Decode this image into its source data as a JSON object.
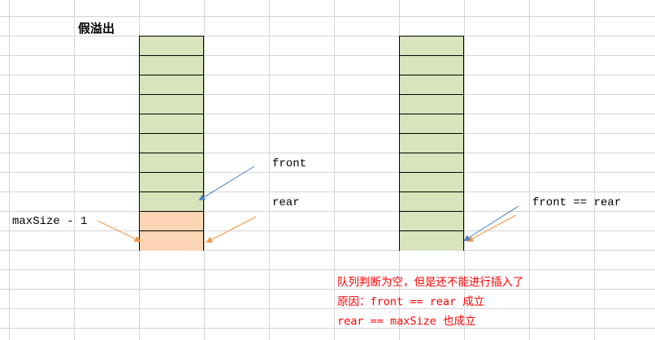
{
  "title": "假溢出",
  "left_queue": {
    "cells": 11,
    "orange_cells": 2
  },
  "right_queue": {
    "cells": 11
  },
  "labels": {
    "front": "front",
    "rear": "rear",
    "max_size_minus_one": "maxSize - 1",
    "front_eq_rear": "front == rear"
  },
  "notes": [
    "队列判断为空，但是还不能进行插入了",
    "原因：front == rear 成立",
    "rear == maxSize  也成立"
  ],
  "colors": {
    "green": "#d8e4bc",
    "orange": "#fcd5b4",
    "blue_arrow": "#4f81bd",
    "orange_arrow": "#f79646",
    "note": "#ff0000"
  }
}
